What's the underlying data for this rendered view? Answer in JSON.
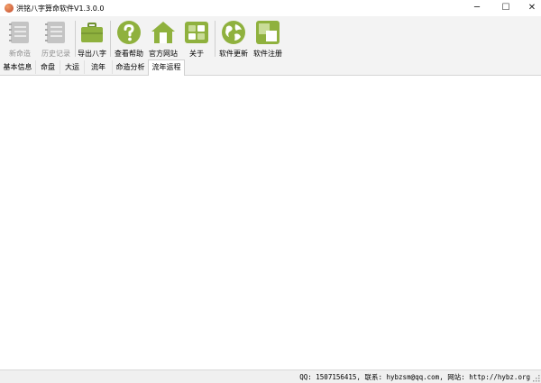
{
  "window": {
    "title": "洪铭八字算命软件V1.3.0.0",
    "minimize_glyph": "─",
    "maximize_glyph": "☐",
    "close_glyph": "✕"
  },
  "toolbar": {
    "items": [
      {
        "label": "新命造",
        "icon": "notebook-icon",
        "enabled": false
      },
      {
        "label": "历史记录",
        "icon": "notebook-icon",
        "enabled": false
      },
      {
        "label": "导出八字",
        "icon": "briefcase-icon",
        "enabled": true
      },
      {
        "label": "查看帮助",
        "icon": "question-icon",
        "enabled": true
      },
      {
        "label": "官方网站",
        "icon": "home-icon",
        "enabled": true
      },
      {
        "label": "关于",
        "icon": "info-blocks-icon",
        "enabled": true
      },
      {
        "label": "软件更新",
        "icon": "globe-icon",
        "enabled": true
      },
      {
        "label": "软件注册",
        "icon": "register-icon",
        "enabled": true
      }
    ],
    "accent_color": "#8fb13e",
    "disabled_color": "#b8b8b8"
  },
  "tabs": [
    {
      "label": "基本信息",
      "active": false
    },
    {
      "label": "命盘",
      "active": false
    },
    {
      "label": "大运",
      "active": false
    },
    {
      "label": "流年",
      "active": false
    },
    {
      "label": "命造分析",
      "active": false
    },
    {
      "label": "流年运程",
      "active": true
    }
  ],
  "status": {
    "text": "QQ: 1507156415, 联系: hybzsm@qq.com, 网站: http://hybz.org"
  }
}
